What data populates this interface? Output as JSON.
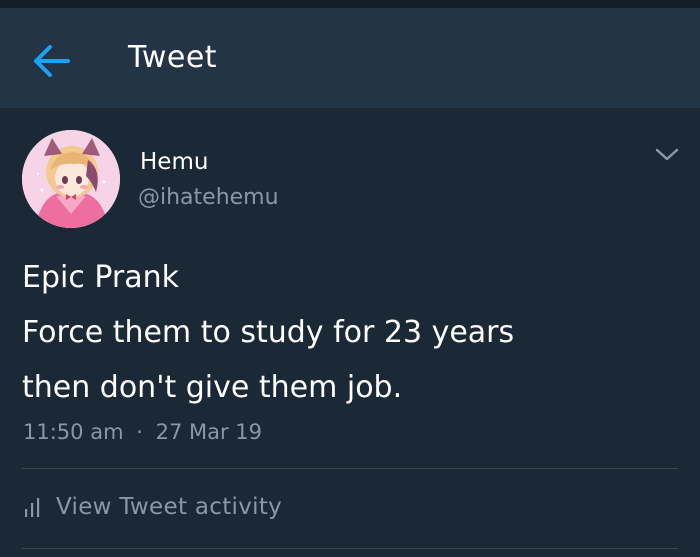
{
  "header": {
    "title": "Tweet",
    "back_icon": "arrow-left-icon"
  },
  "user": {
    "name": "Hemu",
    "handle": "@ihatehemu",
    "avatar_icon": "avatar-image"
  },
  "tweet": {
    "lines": [
      "Epic Prank",
      "Force them to study for 23 years",
      "then don't give them job."
    ],
    "time": "11:50 am",
    "separator": "·",
    "date": "27 Mar 19"
  },
  "activity": {
    "label": "View Tweet activity",
    "icon": "bar-chart-icon"
  },
  "colors": {
    "header_bg": "#243447",
    "content_bg": "#1b2836",
    "accent": "#1da1f2",
    "muted_text": "#8899a6",
    "divider": "#38444d"
  }
}
